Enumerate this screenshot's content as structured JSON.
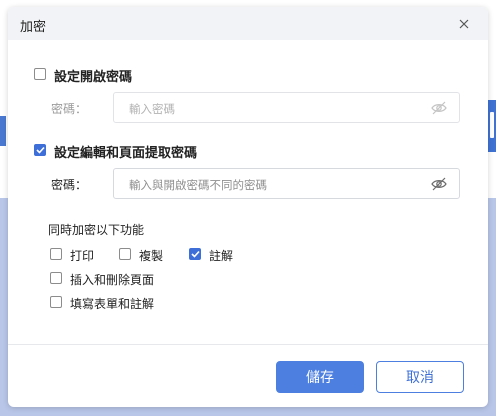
{
  "dialog": {
    "title": "加密",
    "open_password": {
      "checkbox_label": "設定開啟密碼",
      "checked": false,
      "field_label": "密碼：",
      "placeholder": "輸入密碼"
    },
    "edit_password": {
      "checkbox_label": "設定編輯和頁面提取密碼",
      "checked": true,
      "field_label": "密碼：",
      "placeholder": "輸入與開啟密碼不同的密碼"
    },
    "functions": {
      "heading": "同時加密以下功能",
      "print": {
        "label": "打印",
        "checked": false
      },
      "copy": {
        "label": "複製",
        "checked": false
      },
      "annotate": {
        "label": "註解",
        "checked": true
      },
      "insert_delete": {
        "label": "插入和刪除頁面",
        "checked": false
      },
      "fill_sign": {
        "label": "填寫表單和註解",
        "checked": false
      }
    },
    "buttons": {
      "save": "儲存",
      "cancel": "取消"
    }
  },
  "colors": {
    "accent": "#3e6fd8",
    "background_app": "#b9c6e8"
  }
}
